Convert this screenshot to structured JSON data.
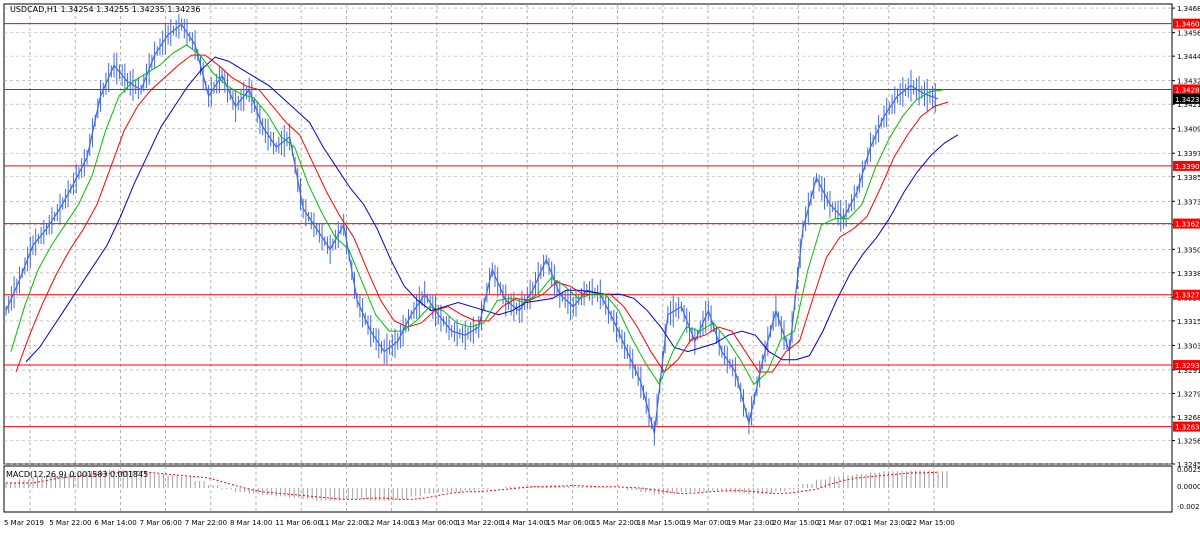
{
  "header": {
    "symbol_info": "USDCAD,H1 1.34254 1.34255 1.34235 1.34236"
  },
  "macd": {
    "label": "MACD(12,26,9) 0.001583 0.001845"
  },
  "colors": {
    "price_line": "#4169e1",
    "hline": "#ff0000",
    "label_bg": "#ff0000",
    "ma_fast": "#00c000",
    "ma_mid": "#ff0000",
    "ma_slow": "#0000cc",
    "grid": "#a0a0a0",
    "current_label_bg": "#000000"
  },
  "chart_data": {
    "type": "line",
    "symbol": "USDCAD",
    "timeframe": "H1",
    "ylim": [
      1.3245,
      1.347
    ],
    "y_ticks": [
      "1.34680",
      "1.34560",
      "1.34445",
      "1.34325",
      "1.34210",
      "1.34090",
      "1.33970",
      "1.33855",
      "1.33735",
      "1.33620",
      "1.33500",
      "1.33385",
      "1.33265",
      "1.33150",
      "1.33030",
      "1.32910",
      "1.32795",
      "1.32680",
      "1.32565",
      "1.32450"
    ],
    "x_ticks": [
      "5 Mar 2019",
      "5 Mar 22:00",
      "6 Mar 14:00",
      "7 Mar 06:00",
      "7 Mar 22:00",
      "8 Mar 14:00",
      "11 Mar 06:00",
      "11 Mar 22:00",
      "12 Mar 14:00",
      "13 Mar 06:00",
      "13 Mar 22:00",
      "14 Mar 14:00",
      "15 Mar 06:00",
      "15 Mar 22:00",
      "18 Mar 15:00",
      "19 Mar 07:00",
      "19 Mar 23:00",
      "20 Mar 15:00",
      "21 Mar 07:00",
      "21 Mar 23:00",
      "22 Mar 15:00"
    ],
    "horizontal_levels": [
      "1.34604",
      "1.34282",
      "1.33908",
      "1.33626",
      "1.33278",
      "1.32934",
      "1.32633"
    ],
    "current_price": "1.34236",
    "price": [
      1.332,
      1.3335,
      1.3352,
      1.336,
      1.337,
      1.3382,
      1.3395,
      1.3425,
      1.344,
      1.3432,
      1.3428,
      1.3445,
      1.3455,
      1.346,
      1.345,
      1.3425,
      1.3435,
      1.342,
      1.3428,
      1.341,
      1.34,
      1.3405,
      1.337,
      1.336,
      1.335,
      1.3362,
      1.3325,
      1.331,
      1.33,
      1.3305,
      1.3318,
      1.3328,
      1.3318,
      1.331,
      1.3308,
      1.3312,
      1.334,
      1.3325,
      1.332,
      1.333,
      1.3345,
      1.3328,
      1.3322,
      1.333,
      1.3328,
      1.3315,
      1.33,
      1.3285,
      1.326,
      1.3318,
      1.3322,
      1.3305,
      1.332,
      1.33,
      1.329,
      1.3265,
      1.3295,
      1.332,
      1.33,
      1.336,
      1.3385,
      1.3372,
      1.3365,
      1.3378,
      1.34,
      1.3415,
      1.3425,
      1.343,
      1.3426,
      1.34236
    ],
    "ma_fast": [
      1.33,
      1.3322,
      1.334,
      1.3352,
      1.3362,
      1.3372,
      1.3386,
      1.3408,
      1.3425,
      1.3432,
      1.3436,
      1.344,
      1.3446,
      1.345,
      1.3445,
      1.3436,
      1.343,
      1.3426,
      1.3424,
      1.3416,
      1.3405,
      1.34,
      1.3382,
      1.3368,
      1.3356,
      1.335,
      1.3334,
      1.3318,
      1.331,
      1.331,
      1.3315,
      1.3322,
      1.332,
      1.3314,
      1.3312,
      1.3314,
      1.3325,
      1.3326,
      1.3324,
      1.3328,
      1.3336,
      1.3332,
      1.3326,
      1.3328,
      1.3328,
      1.332,
      1.3306,
      1.3294,
      1.3284,
      1.33,
      1.3312,
      1.331,
      1.3314,
      1.3306,
      1.3296,
      1.3284,
      1.329,
      1.3306,
      1.331,
      1.334,
      1.3362,
      1.3365,
      1.3365,
      1.3372,
      1.339,
      1.3404,
      1.3415,
      1.3423,
      1.3427,
      1.3428
    ],
    "ma_mid": [
      1.329,
      1.3308,
      1.3324,
      1.3338,
      1.335,
      1.336,
      1.3372,
      1.339,
      1.3408,
      1.342,
      1.3428,
      1.3434,
      1.344,
      1.3445,
      1.3445,
      1.344,
      1.3434,
      1.343,
      1.3428,
      1.342,
      1.3412,
      1.3406,
      1.3392,
      1.3378,
      1.3366,
      1.3356,
      1.334,
      1.3325,
      1.3315,
      1.3312,
      1.3314,
      1.332,
      1.3322,
      1.3318,
      1.3315,
      1.3315,
      1.3322,
      1.3326,
      1.3325,
      1.3328,
      1.3334,
      1.3332,
      1.3328,
      1.3328,
      1.3328,
      1.3322,
      1.3312,
      1.33,
      1.329,
      1.3296,
      1.3306,
      1.3308,
      1.3312,
      1.331,
      1.33,
      1.329,
      1.329,
      1.33,
      1.3305,
      1.3326,
      1.3346,
      1.3356,
      1.336,
      1.3366,
      1.338,
      1.3395,
      1.3406,
      1.3415,
      1.342,
      1.3422
    ],
    "ma_slow": [
      1.3295,
      1.3302,
      1.3312,
      1.3322,
      1.3332,
      1.3342,
      1.3352,
      1.3366,
      1.3382,
      1.3396,
      1.341,
      1.342,
      1.343,
      1.3438,
      1.3444,
      1.3442,
      1.3438,
      1.3434,
      1.343,
      1.3424,
      1.3418,
      1.3412,
      1.34,
      1.339,
      1.338,
      1.3372,
      1.336,
      1.3345,
      1.3332,
      1.3325,
      1.332,
      1.3322,
      1.3324,
      1.3322,
      1.332,
      1.3318,
      1.332,
      1.3324,
      1.3325,
      1.3326,
      1.333,
      1.333,
      1.3329,
      1.3328,
      1.3328,
      1.3326,
      1.332,
      1.3312,
      1.3302,
      1.33,
      1.3302,
      1.3304,
      1.3308,
      1.331,
      1.3308,
      1.33,
      1.3296,
      1.3296,
      1.3298,
      1.331,
      1.3325,
      1.3338,
      1.3348,
      1.3356,
      1.3366,
      1.3378,
      1.3388,
      1.3396,
      1.3402,
      1.3406
    ],
    "macd_hist": [
      0.8,
      1.2,
      1.6,
      1.8,
      2.0,
      2.2,
      2.4,
      2.6,
      2.6,
      2.4,
      2.2,
      2.0,
      1.8,
      1.6,
      1.0,
      0.4,
      -0.2,
      -0.6,
      -0.8,
      -1.0,
      -1.2,
      -1.4,
      -1.6,
      -1.8,
      -1.8,
      -1.6,
      -1.6,
      -1.8,
      -1.8,
      -1.6,
      -1.2,
      -0.8,
      -0.6,
      -0.6,
      -0.4,
      -0.2,
      0.0,
      0.2,
      0.2,
      0.3,
      0.4,
      0.3,
      0.2,
      0.2,
      0.1,
      0.0,
      -0.3,
      -0.6,
      -0.9,
      -0.8,
      -0.6,
      -0.5,
      -0.4,
      -0.5,
      -0.7,
      -0.9,
      -0.8,
      -0.5,
      -0.2,
      0.6,
      1.2,
      1.6,
      1.8,
      2.0,
      2.2,
      2.4,
      2.4,
      2.5,
      2.5,
      2.4
    ]
  }
}
